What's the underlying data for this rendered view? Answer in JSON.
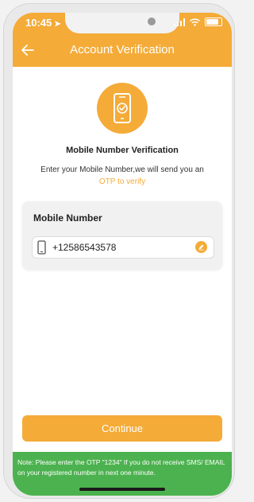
{
  "status": {
    "time": "10:45"
  },
  "header": {
    "title": "Account Verification"
  },
  "icons": {
    "back": "back-arrow-icon",
    "hero": "mobile-verified-icon",
    "field": "mobile-phone-icon",
    "edit": "pencil-edit-icon"
  },
  "intro": {
    "title": "Mobile Number  Verification",
    "desc": "Enter your Mobile Number,we will send you an",
    "highlight": "OTP to verify"
  },
  "form": {
    "label": "Mobile Number",
    "value": "+12586543578"
  },
  "actions": {
    "continue": "Continue"
  },
  "footer": {
    "note": "Note: Please enter the OTP \"1234\" If you do not receive SMS/ EMAIL on your registered number in next one minute."
  },
  "colors": {
    "accent": "#f4ab38",
    "note_bar": "#4cb24f"
  }
}
